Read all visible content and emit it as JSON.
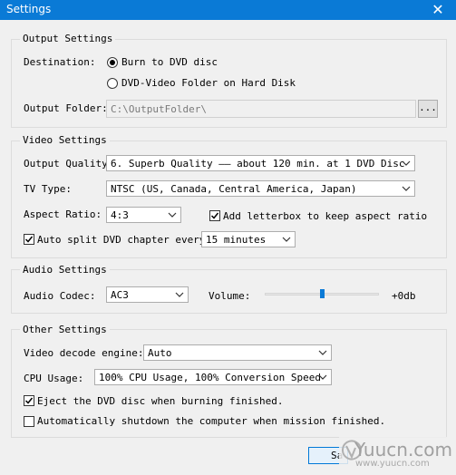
{
  "window": {
    "title": "Settings",
    "close_glyph": "✕"
  },
  "output_settings": {
    "legend": "Output Settings",
    "destination_label": "Destination:",
    "options": [
      "Burn to DVD disc",
      "DVD-Video Folder on Hard Disk"
    ],
    "selected_option": "Burn to DVD disc",
    "output_folder_label": "Output Folder:",
    "output_folder_value": "C:\\OutputFolder\\",
    "browse_label": "..."
  },
  "video_settings": {
    "legend": "Video Settings",
    "quality_label": "Output Quality:",
    "quality_value": "6. Superb Quality —— about 120 min. at 1 DVD Disc",
    "tv_type_label": "TV Type:",
    "tv_type_value": "NTSC (US, Canada, Central America, Japan)",
    "aspect_label": "Aspect Ratio:",
    "aspect_value": "4:3",
    "letterbox_label": "Add letterbox to keep aspect ratio",
    "letterbox_checked": true,
    "auto_split_label": "Auto split DVD chapter every",
    "auto_split_checked": true,
    "auto_split_value": "15 minutes"
  },
  "audio_settings": {
    "legend": "Audio Settings",
    "codec_label": "Audio Codec:",
    "codec_value": "AC3",
    "volume_label": "Volume:",
    "volume_value": "+0db",
    "volume_level": 0.5
  },
  "other_settings": {
    "legend": "Other Settings",
    "decode_label": "Video decode engine:",
    "decode_value": "Auto",
    "cpu_label": "CPU Usage:",
    "cpu_value": "100% CPU Usage, 100% Conversion Speed",
    "eject_label": "Eject the DVD disc when burning finished.",
    "eject_checked": true,
    "shutdown_label": "Automatically shutdown the computer when  mission finished.",
    "shutdown_checked": false
  },
  "footer": {
    "save_label": "Sa"
  },
  "watermark": {
    "text": "Yuucn.com",
    "sub": "www.yuucn.com"
  },
  "colors": {
    "titlebar": "#0a7ad6",
    "accent": "#0078d7",
    "background": "#f0f0f0"
  }
}
